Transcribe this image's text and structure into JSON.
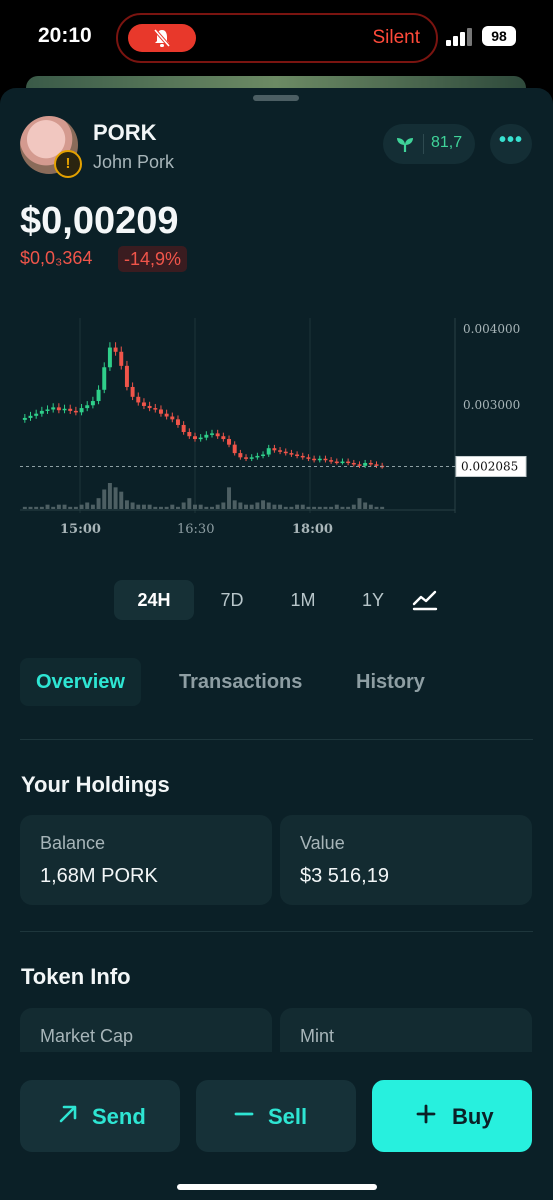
{
  "status_bar": {
    "time": "20:10",
    "focus_label": "Silent",
    "battery": "98"
  },
  "header": {
    "symbol": "PORK",
    "name": "John Pork",
    "warning_glyph": "!",
    "score": "81,7",
    "more_glyph": "•••",
    "score_color": "#3fd399"
  },
  "price": {
    "value": "$0,00209",
    "change_abs": "$0,0₃364",
    "change_pct": "-14,9%",
    "down_color": "#f0554a"
  },
  "chart_data": {
    "type": "candlestick",
    "y_ticks": [
      "0.004000",
      "0.003000"
    ],
    "last_price_label": "0.002085",
    "x_ticks": [
      "15:00",
      "16:30",
      "18:00"
    ],
    "ylim": [
      0.0015,
      0.0042
    ],
    "close": [
      0.00278,
      0.00281,
      0.00284,
      0.00288,
      0.0029,
      0.00293,
      0.00289,
      0.00291,
      0.00288,
      0.00286,
      0.00292,
      0.00296,
      0.00302,
      0.00318,
      0.0035,
      0.00378,
      0.00372,
      0.00352,
      0.00322,
      0.00308,
      0.003,
      0.00295,
      0.00292,
      0.0029,
      0.00284,
      0.0028,
      0.00276,
      0.00268,
      0.00258,
      0.00252,
      0.00248,
      0.0025,
      0.00254,
      0.00256,
      0.00252,
      0.00248,
      0.0024,
      0.00228,
      0.00222,
      0.0022,
      0.00222,
      0.00224,
      0.00226,
      0.00235,
      0.00232,
      0.0023,
      0.00228,
      0.00226,
      0.00224,
      0.00222,
      0.0022,
      0.00218,
      0.0022,
      0.00218,
      0.00216,
      0.00215,
      0.00216,
      0.00214,
      0.00212,
      0.0021,
      0.00214,
      0.00212,
      0.0021,
      0.00209
    ],
    "volume": [
      1,
      1,
      1,
      1,
      2,
      1,
      2,
      2,
      1,
      1,
      2,
      3,
      2,
      5,
      9,
      12,
      10,
      8,
      4,
      3,
      2,
      2,
      2,
      1,
      1,
      1,
      2,
      1,
      3,
      5,
      2,
      2,
      1,
      1,
      2,
      3,
      10,
      4,
      3,
      2,
      2,
      3,
      4,
      3,
      2,
      2,
      1,
      1,
      2,
      2,
      1,
      1,
      1,
      1,
      1,
      2,
      1,
      1,
      2,
      5,
      3,
      2,
      1,
      1
    ],
    "up_color": "#2fcf8a",
    "down_color": "#f0554a"
  },
  "timeframes": [
    "24H",
    "7D",
    "1M",
    "1Y"
  ],
  "tabs": [
    "Overview",
    "Transactions",
    "History"
  ],
  "holdings": {
    "title": "Your Holdings",
    "balance_label": "Balance",
    "balance_value": "1,68M PORK",
    "value_label": "Value",
    "value_value": "$3 516,19"
  },
  "token_info": {
    "title": "Token Info",
    "market_cap_label": "Market Cap",
    "mint_label": "Mint"
  },
  "actions": {
    "send": "Send",
    "sell": "Sell",
    "buy": "Buy"
  },
  "accent_color": "#2ee5d3"
}
